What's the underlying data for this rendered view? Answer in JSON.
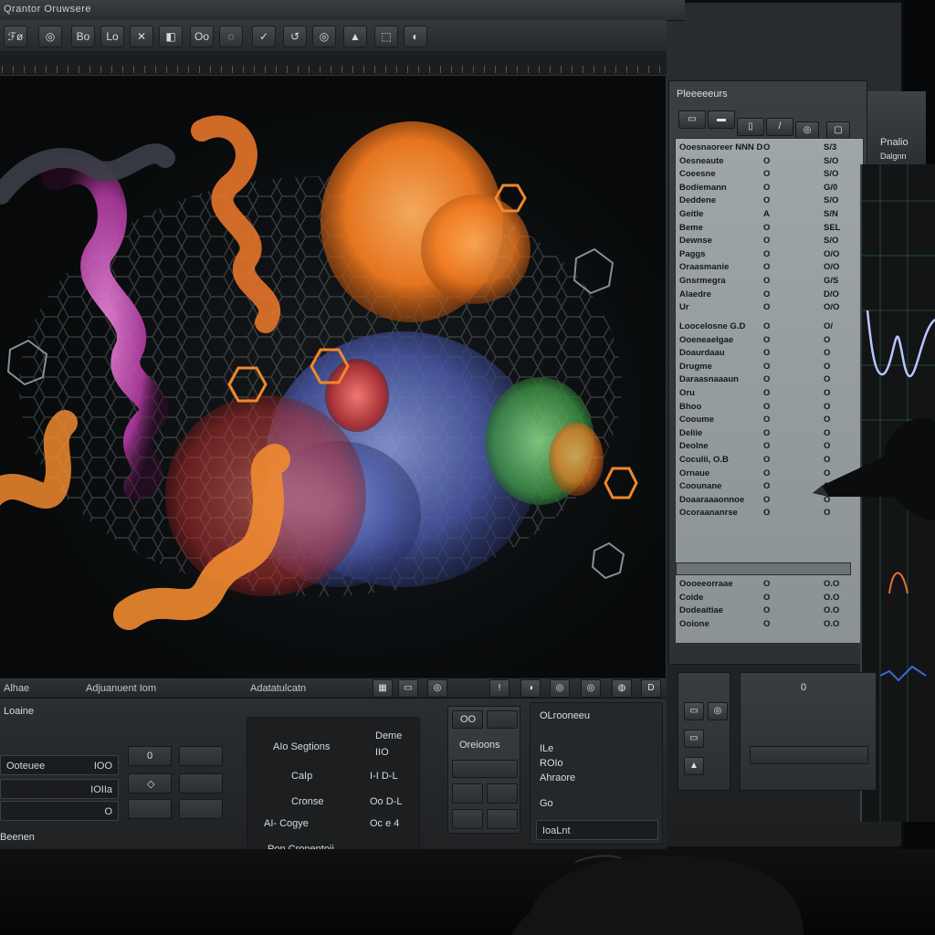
{
  "window": {
    "title": "Qrantor Oruwsere"
  },
  "toolbar": {
    "buttons": [
      "ℱø",
      "◎",
      "Bo",
      "Lo",
      "✕",
      "◧",
      "Oo",
      "◌",
      "✓",
      "↺",
      "◎",
      "▲",
      "⬚",
      "◐"
    ]
  },
  "viewport_footer": {
    "left_label": "Alhae",
    "center_label": "Adjuanuent Iom",
    "right_label": "Adatatulcatn"
  },
  "side_panel": {
    "header": "Pleeeeeurs",
    "right_header": "Pnalio",
    "right_sub": "Dalgnn",
    "rows_a": [
      {
        "name": "Ooesnaoreer NNN D",
        "v1": "O",
        "v2": "S/3"
      },
      {
        "name": "Oesneaute",
        "v1": "O",
        "v2": "S/O"
      },
      {
        "name": "Coeesne",
        "v1": "O",
        "v2": "S/O"
      },
      {
        "name": "Bodiemann",
        "v1": "O",
        "v2": "G/0"
      },
      {
        "name": "Deddene",
        "v1": "O",
        "v2": "S/O"
      },
      {
        "name": "Geitle",
        "v1": "A",
        "v2": "S/N"
      },
      {
        "name": "Beme",
        "v1": "O",
        "v2": "SEL"
      },
      {
        "name": "Dewnse",
        "v1": "O",
        "v2": "S/O"
      },
      {
        "name": "Paggs",
        "v1": "O",
        "v2": "O/O"
      },
      {
        "name": "Oraasmanie",
        "v1": "O",
        "v2": "O/O"
      },
      {
        "name": "Gnsrmegra",
        "v1": "O",
        "v2": "G/S"
      },
      {
        "name": "Alaedre",
        "v1": "O",
        "v2": "D/O"
      },
      {
        "name": "Ur",
        "v1": "O",
        "v2": "O/O"
      }
    ],
    "rows_b": [
      {
        "name": "Loocelosne G.D",
        "v1": "O",
        "v2": "O/"
      },
      {
        "name": "Ooeneaelgae",
        "v1": "O",
        "v2": "O"
      },
      {
        "name": "Doaurdaau",
        "v1": "O",
        "v2": "O"
      },
      {
        "name": "Drugme",
        "v1": "O",
        "v2": "O"
      },
      {
        "name": "Daraasnaaaun",
        "v1": "O",
        "v2": "O"
      },
      {
        "name": "Oru",
        "v1": "O",
        "v2": "O"
      },
      {
        "name": "Bhoo",
        "v1": "O",
        "v2": "O"
      },
      {
        "name": "Cooume",
        "v1": "O",
        "v2": "O"
      },
      {
        "name": "Deliie",
        "v1": "O",
        "v2": "O"
      },
      {
        "name": "Deolne",
        "v1": "O",
        "v2": "O"
      },
      {
        "name": "Coculii, O.B",
        "v1": "O",
        "v2": "O"
      },
      {
        "name": "Ornaue",
        "v1": "O",
        "v2": "O"
      },
      {
        "name": "Coounane",
        "v1": "O",
        "v2": "O"
      },
      {
        "name": "Doaaraaaonnoe",
        "v1": "O",
        "v2": "O"
      },
      {
        "name": "Ocoraananrse",
        "v1": "O",
        "v2": "O"
      }
    ],
    "rows_c": [
      {
        "name": "Oooeeorraae",
        "v1": "O",
        "v2": "O.O"
      },
      {
        "name": "Coide",
        "v1": "O",
        "v2": "O.O"
      },
      {
        "name": "Dodeaitiae",
        "v1": "O",
        "v2": "O.O"
      },
      {
        "name": "Ooione",
        "v1": "O",
        "v2": "O.O"
      }
    ]
  },
  "bottom_panel": {
    "left_label": "Loaine",
    "fields_left": [
      {
        "label": "Ooteuee",
        "value": "IOO"
      },
      {
        "label": "",
        "value": "IOIIa"
      },
      {
        "label": "",
        "value": "O"
      }
    ],
    "bottom_left_label": "Beenen",
    "group_a": {
      "rows": [
        {
          "label": "AIo Segtions",
          "value": "Deme"
        },
        {
          "label": "",
          "value": "IIO"
        },
        {
          "label": "CaIp",
          "value": "I-I D-L"
        },
        {
          "label": "Cronse",
          "value": "Oo D-L"
        },
        {
          "label": "AI- Cogye",
          "value": "Oc e 4"
        }
      ],
      "footer": "Pon Cronentoii"
    },
    "group_b": {
      "head": "OO",
      "rows": [
        "Oreioons",
        "—",
        "I",
        "I",
        "I"
      ]
    },
    "group_c": {
      "head": "OLrooneeu",
      "rows": [
        "ILe",
        "ROIo",
        "Ahraore"
      ],
      "bottom_label": "Go",
      "bottom_value": "IoaLnt"
    }
  }
}
